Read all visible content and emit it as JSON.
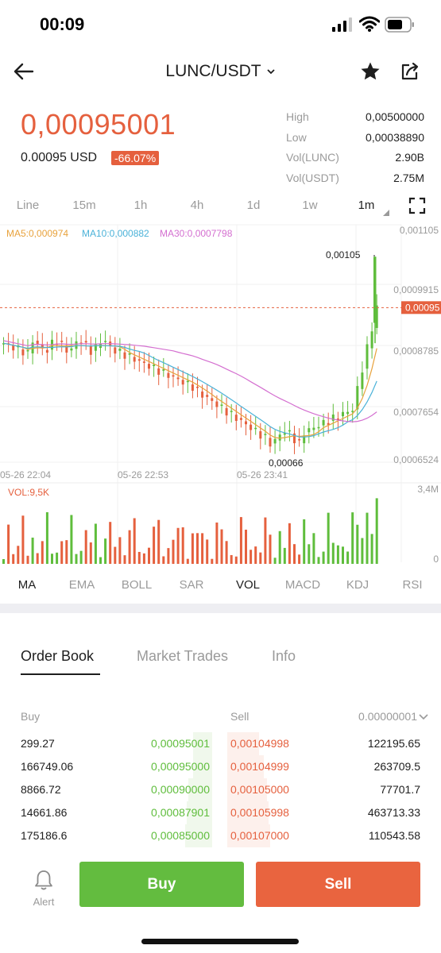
{
  "status_bar": {
    "time": "00:09"
  },
  "header": {
    "pair": "LUNC/USDT"
  },
  "price": {
    "last": "0,00095001",
    "usd": "0.00095 USD",
    "change": "-66.07%"
  },
  "stats": [
    {
      "label": "High",
      "value": "0,00500000"
    },
    {
      "label": "Low",
      "value": "0,00038890"
    },
    {
      "label": "Vol(LUNC)",
      "value": "2.90B"
    },
    {
      "label": "Vol(USDT)",
      "value": "2.75M"
    }
  ],
  "intervals": [
    "Line",
    "15m",
    "1h",
    "4h",
    "1d",
    "1w",
    "1m"
  ],
  "active_interval": "1m",
  "chart_labels": {
    "ma5": "MA5:0,000974",
    "ma10": "MA10:0,000882",
    "ma30": "MA30:0,0007798",
    "y_ticks": [
      "0,001105",
      "0,0009915",
      "0,0008785",
      "0,0007654",
      "0,0006524"
    ],
    "current_price_tag": "0,00095",
    "max_label": "0,00105",
    "min_label": "0,00066",
    "x_ticks": [
      "05-26 22:04",
      "05-26 22:53",
      "05-26 23:41"
    ],
    "vol_label": "VOL:9,5K",
    "vol_ticks": [
      "3,4M",
      "0"
    ]
  },
  "chart_data": {
    "type": "candlestick",
    "y_range": [
      0.0006524,
      0.001105
    ],
    "current_price": 0.00095,
    "max_price": 0.00105,
    "min_price": 0.00066,
    "x_ticks": [
      "05-26 22:04",
      "05-26 22:53",
      "05-26 23:41"
    ],
    "series": [
      {
        "name": "MA5",
        "last": 0.000974
      },
      {
        "name": "MA10",
        "last": 0.000882
      },
      {
        "name": "MA30",
        "last": 0.0007798
      }
    ],
    "volume_range": [
      "0",
      "3,4M"
    ]
  },
  "colors": {
    "up": "#5fbd3c",
    "down": "#e5603e",
    "ma5": "#e8a23c",
    "ma10": "#4bb2d8",
    "ma30": "#d46fd0"
  },
  "indicators": [
    "MA",
    "EMA",
    "BOLL",
    "SAR",
    "VOL",
    "MACD",
    "KDJ",
    "RSI"
  ],
  "orderbook": {
    "tabs": [
      "Order Book",
      "Market Trades",
      "Info"
    ],
    "buy_header": "Buy",
    "sell_header": "Sell",
    "precision": "0.00000001",
    "rows": [
      {
        "buy_qty": "299.27",
        "buy_price": "0,00095001",
        "sell_price": "0,00104998",
        "sell_qty": "122195.65"
      },
      {
        "buy_qty": "166749.06",
        "buy_price": "0,00095000",
        "sell_price": "0,00104999",
        "sell_qty": "263709.5"
      },
      {
        "buy_qty": "8866.72",
        "buy_price": "0,00090000",
        "sell_price": "0,00105000",
        "sell_qty": "77701.7"
      },
      {
        "buy_qty": "14661.86",
        "buy_price": "0,00087901",
        "sell_price": "0,00105998",
        "sell_qty": "463713.33"
      },
      {
        "buy_qty": "175186.6",
        "buy_price": "0,00085000",
        "sell_price": "0,00107000",
        "sell_qty": "110543.58"
      }
    ]
  },
  "bottom": {
    "alert": "Alert",
    "buy": "Buy",
    "sell": "Sell"
  }
}
